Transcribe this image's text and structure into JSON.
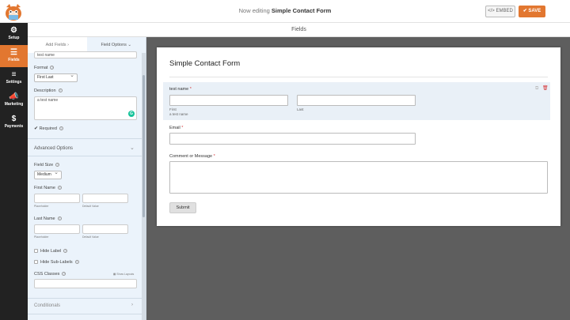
{
  "header": {
    "title_prefix": "Now editing",
    "form_name": "Simple Contact Form",
    "embed_label": "EMBED",
    "embed_icon": "</>",
    "save_label": "SAVE",
    "save_icon": "✔",
    "accent_color": "#e27730"
  },
  "nav": {
    "items": [
      {
        "label": "Setup",
        "icon": "gear-icon",
        "glyph": "⚙"
      },
      {
        "label": "Fields",
        "icon": "fields-icon",
        "glyph": "☰"
      },
      {
        "label": "Settings",
        "icon": "sliders-icon",
        "glyph": "≡"
      },
      {
        "label": "Marketing",
        "icon": "megaphone-icon",
        "glyph": "📣"
      },
      {
        "label": "Payments",
        "icon": "dollar-icon",
        "glyph": "$"
      }
    ],
    "active_index": 1
  },
  "subheader": {
    "title": "Fields"
  },
  "panel": {
    "tab_add": "Add Fields ›",
    "tab_options": "Field Options ⌄",
    "label_value": "test name",
    "format_label": "Format",
    "format_value": "First Last",
    "description_label": "Description",
    "description_value": "a test name",
    "required_label": "Required",
    "required_checked": true,
    "advanced_title": "Advanced Options",
    "field_size_label": "Field Size",
    "field_size_value": "Medium",
    "first_name_label": "First Name",
    "last_name_label": "Last Name",
    "placeholder_sub": "Placeholder",
    "default_sub": "Default Value",
    "hide_label": "Hide Label",
    "hide_sublabels": "Hide Sub-Labels",
    "css_classes_label": "CSS Classes",
    "show_layouts": "Show Layouts",
    "conditionals_title": "Conditionals"
  },
  "form": {
    "title": "Simple Contact Form",
    "name_field": {
      "label": "test name",
      "first_sub": "First",
      "last_sub": "Last",
      "description": "a test name"
    },
    "email_field": {
      "label": "Email"
    },
    "comment_field": {
      "label": "Comment or Message"
    },
    "submit_label": "Submit",
    "required_mark": "*"
  }
}
